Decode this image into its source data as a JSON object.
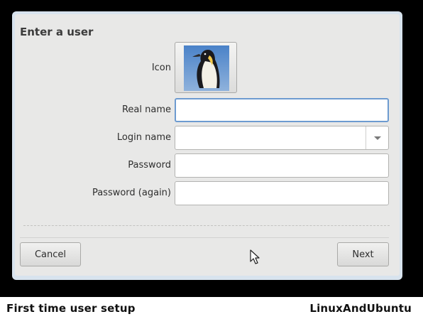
{
  "dialog": {
    "title": "Enter a user",
    "fields": {
      "icon_label": "Icon",
      "real_name_label": "Real name",
      "real_name_value": "",
      "login_name_label": "Login name",
      "login_name_value": "",
      "password_label": "Password",
      "password_value": "",
      "password_again_label": "Password (again)",
      "password_again_value": ""
    },
    "buttons": {
      "cancel": "Cancel",
      "next": "Next"
    }
  },
  "caption": {
    "left": "First time user setup",
    "right": "LinuxAndUbuntu"
  },
  "colors": {
    "focus_border": "#6d9bd0",
    "window_background": "#e8e8e7",
    "screen_background": "#000000"
  },
  "icons": {
    "user_icon": "penguin-photo",
    "combo_arrow": "chevron-down-icon",
    "pointer": "mouse-cursor-icon"
  }
}
